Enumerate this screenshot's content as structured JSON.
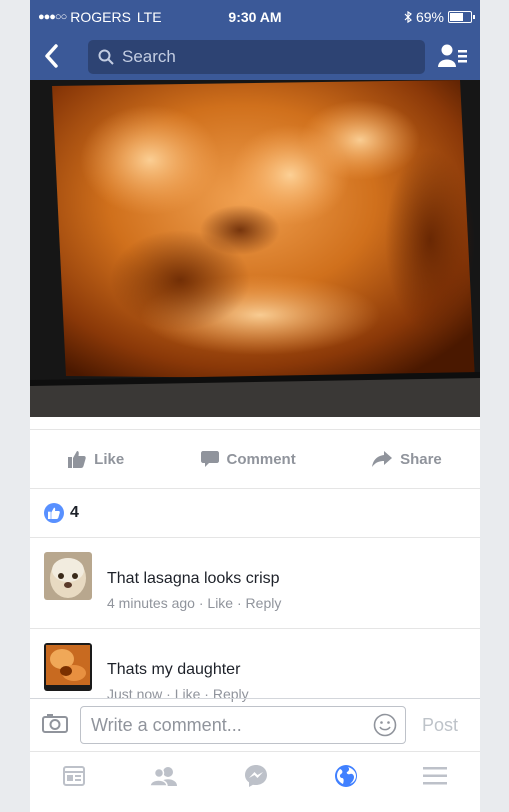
{
  "status_bar": {
    "signal": "●●●○○",
    "carrier": "ROGERS",
    "network": "LTE",
    "time": "9:30 AM",
    "bluetooth_icon": "bluetooth-icon",
    "battery": "69%",
    "battery_level": 0.69
  },
  "nav": {
    "back_icon": "chevron-left-icon",
    "search_placeholder": "Search",
    "friends_icon": "friend-requests-icon"
  },
  "post": {
    "photo_description": "ultrasound-image",
    "actions": [
      {
        "label": "Like"
      },
      {
        "label": "Comment"
      },
      {
        "label": "Share"
      }
    ],
    "like_count": "4"
  },
  "comments": [
    {
      "text": "That lasagna looks crisp",
      "time": "4 minutes ago",
      "like": "Like",
      "reply": "Reply"
    },
    {
      "text": "Thats my daughter",
      "time": "Just now",
      "like": "Like",
      "reply": "Reply"
    }
  ],
  "composer": {
    "placeholder": "Write a comment...",
    "post_label": "Post",
    "camera_icon": "camera-icon",
    "emoji_icon": "smiley-icon"
  },
  "tab_bar": [
    "news-feed-icon",
    "friends-icon",
    "messenger-icon",
    "globe-notifications-icon",
    "menu-icon"
  ],
  "colors": {
    "brand": "#3b5998",
    "like_blue": "#5890ff",
    "active_tab": "#4080ff"
  }
}
